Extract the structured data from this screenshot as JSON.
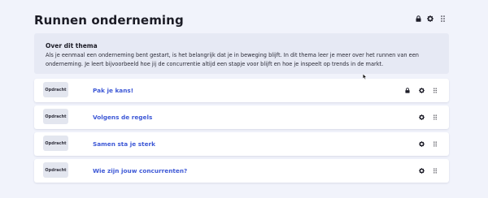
{
  "header": {
    "title": "Runnen onderneming",
    "icons": [
      "lock-icon",
      "gear-icon",
      "drag-handle-icon"
    ]
  },
  "theme": {
    "title": "Over dit thema",
    "description": "Als je eenmaal een onderneming bent gestart, is het belangrijk dat je in beweging blijft. In dit thema leer je meer over het runnen van een onderneming. Je leert bijvoorbeeld hoe jij de concurrentie altijd een stapje voor blijft en hoe je inspeelt op trends in de markt."
  },
  "assignments": [
    {
      "badge": "Opdracht",
      "title": "Pak je kans!",
      "locked": true
    },
    {
      "badge": "Opdracht",
      "title": "Volgens de regels",
      "locked": false
    },
    {
      "badge": "Opdracht",
      "title": "Samen sta je sterk",
      "locked": false
    },
    {
      "badge": "Opdracht",
      "title": "Wie zijn jouw concurrenten?",
      "locked": false
    }
  ],
  "colors": {
    "background": "#f1f3fb",
    "accent": "#3d58d6",
    "theme_box": "#e6e9f4",
    "badge": "#e3e6ef"
  }
}
